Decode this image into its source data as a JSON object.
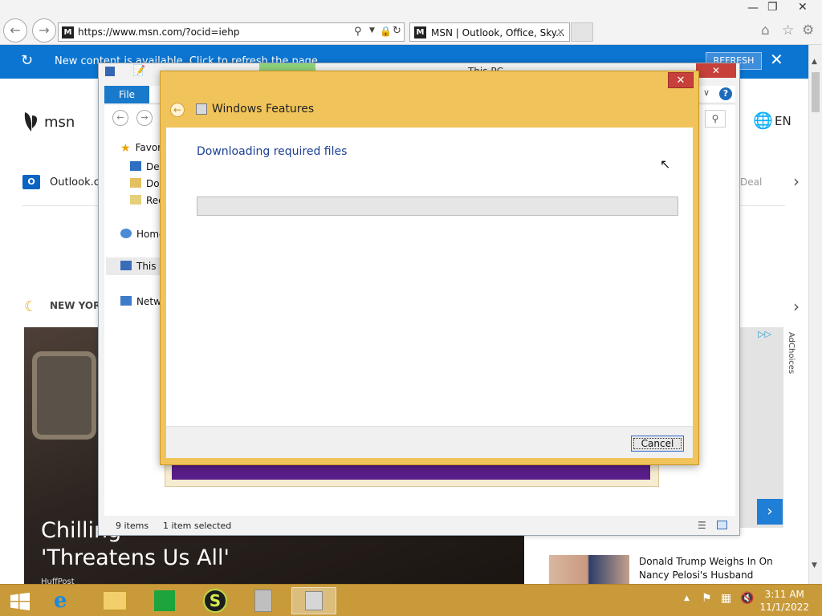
{
  "browser": {
    "address_url": "https://www.msn.com/?ocid=iehp",
    "tab_title": "MSN | Outlook, Office, Sky...",
    "tab_close": "×"
  },
  "msn": {
    "banner_text": "New content is available. Click to refresh the page.",
    "refresh_label": "REFRESH",
    "close_glyph": "✕",
    "logo_text": "msn",
    "lang": "EN",
    "outlook_label": "Outlook.co",
    "deals_label": "Deal",
    "weather_label": "NEW YORK",
    "adchoices": "AdChoices",
    "hero_line1": "Chilling",
    "hero_line2": "'Threatens Us All'",
    "hero_source": "HuffPost",
    "story_title": "Donald Trump Weighs In On Nancy Pelosi's Husband"
  },
  "explorer": {
    "title": "This PC",
    "file_tab": "File",
    "nav": {
      "favorites": "Favorites",
      "desktop": "Desktop",
      "downloads": "Downloads",
      "recent": "Recent places",
      "homegroup": "Homegroup",
      "thispc": "This PC",
      "network": "Network"
    },
    "status_items": "9 items",
    "status_selected": "1 item selected"
  },
  "dialog": {
    "title": "Windows Features",
    "close_glyph": "✕",
    "heading": "Downloading required files",
    "progress": 0,
    "cancel_label": "Cancel"
  },
  "taskbar": {
    "time": "3:11 AM",
    "date": "11/1/2022"
  },
  "colors": {
    "accent_blue": "#0b75d1",
    "dialog_frame": "#f0c45a",
    "taskbar": "#c89a3a"
  }
}
